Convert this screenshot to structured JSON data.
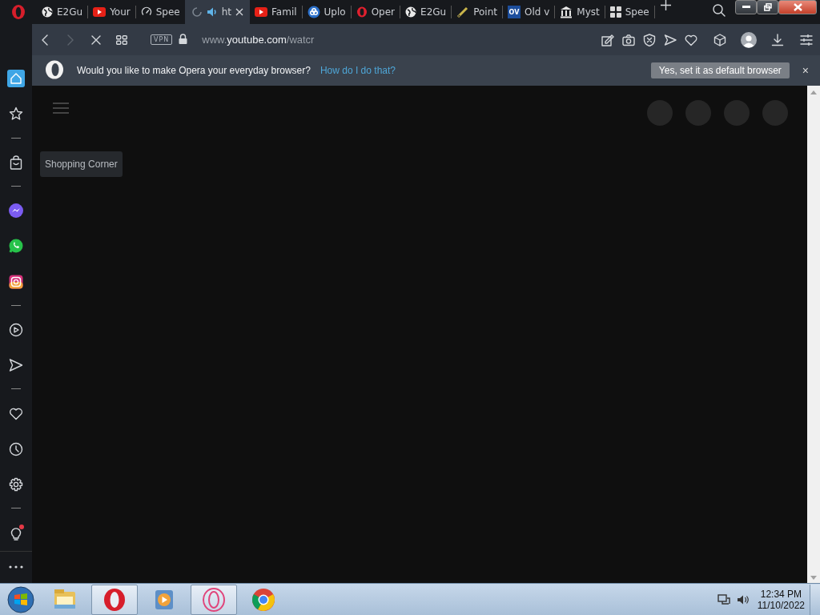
{
  "tabs": [
    {
      "title": "E2Gu",
      "kind": "globe",
      "selected": false
    },
    {
      "title": "Your",
      "kind": "youtube",
      "selected": false
    },
    {
      "title": "Spee",
      "kind": "gauge",
      "selected": false
    },
    {
      "title": "ht",
      "kind": "speaker",
      "selected": true,
      "loading": true
    },
    {
      "title": "Famil",
      "kind": "youtube",
      "selected": false
    },
    {
      "title": "Uplo",
      "kind": "cloud",
      "selected": false
    },
    {
      "title": "Oper",
      "kind": "opera",
      "selected": false
    },
    {
      "title": "E2Gu",
      "kind": "globe",
      "selected": false
    },
    {
      "title": "Point",
      "kind": "pencil",
      "selected": false
    },
    {
      "title": "Old v",
      "kind": "badge",
      "badge": "OV",
      "selected": false
    },
    {
      "title": "Myst",
      "kind": "museum",
      "selected": false
    },
    {
      "title": "Spee",
      "kind": "grid",
      "selected": false
    }
  ],
  "address_bar": {
    "vpn": "VPN",
    "url": {
      "prefix": "www.",
      "domain": "youtube.com",
      "path": "/watcr"
    },
    "forward_disabled": true
  },
  "banner": {
    "message": "Would you like to make Opera your everyday browser?",
    "link": "How do I do that?",
    "button": "Yes, set it as default browser",
    "close": "×"
  },
  "sidebar": {
    "items": [
      {
        "kind": "home",
        "selected": true
      },
      {
        "kind": "star",
        "selected": false
      },
      {
        "kind": "separator"
      },
      {
        "kind": "bag",
        "selected": false
      },
      {
        "kind": "separator"
      },
      {
        "kind": "messenger",
        "selected": false
      },
      {
        "kind": "whatsapp",
        "selected": false
      },
      {
        "kind": "instagram",
        "selected": false
      },
      {
        "kind": "separator"
      },
      {
        "kind": "player",
        "selected": false
      },
      {
        "kind": "send",
        "selected": false
      },
      {
        "kind": "separator"
      },
      {
        "kind": "heart",
        "selected": false
      },
      {
        "kind": "clock",
        "selected": false
      },
      {
        "kind": "gear",
        "selected": false
      },
      {
        "kind": "separator"
      },
      {
        "kind": "bulb",
        "selected": false,
        "notification": true
      }
    ],
    "tooltip": "Shopping Corner"
  },
  "taskbar": {
    "apps": [
      {
        "kind": "explorer",
        "active": false
      },
      {
        "kind": "opera",
        "active": true
      },
      {
        "kind": "media",
        "active": false
      },
      {
        "kind": "operagx",
        "active": true
      },
      {
        "kind": "chrome",
        "active": false
      }
    ],
    "time": "12:34 PM",
    "date": "11/10/2022"
  }
}
